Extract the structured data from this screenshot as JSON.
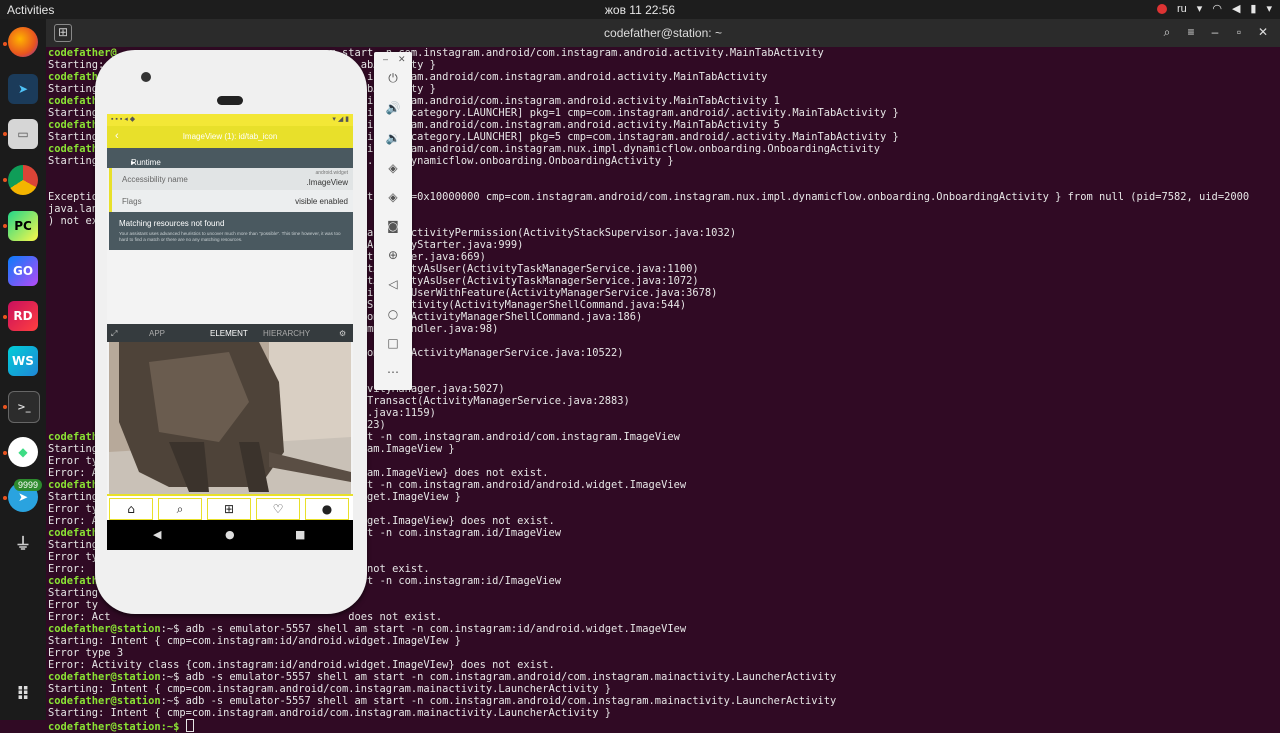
{
  "topbar": {
    "activities": "Activities",
    "clock": "жов 11  22:56",
    "lang": "ru"
  },
  "dock": {
    "telegram_badge": "9999"
  },
  "terminal": {
    "title": "codefather@station: ~",
    "prompt": "codefather@station:~$"
  },
  "inspector": {
    "header_title": "ImageView (1): id/tab_icon",
    "runtime_state": "Runtime state",
    "accessibility_label": "Accessibility name",
    "accessibility_value_small": "android.widget",
    "accessibility_value": ".ImageView",
    "flags_label": "Flags",
    "flags_value": "visible  enabled",
    "not_found_title": "Matching resources not found",
    "not_found_desc": "Your assistant uses advanced heuristics to uncover much more than \"possible\". This time however, it was too hard to find a match or there are no any matching resources.",
    "tabs": [
      "APP",
      "ELEMENT",
      "HIERARCHY"
    ]
  },
  "icons": {
    "power": "power-icon",
    "vol_up": "volume-up-icon",
    "vol_down": "volume-down-icon",
    "rotate_left": "rotate-left-icon",
    "rotate_right": "rotate-right-icon",
    "camera": "camera-icon",
    "zoom": "zoom-icon",
    "back": "back-icon",
    "home": "home-icon",
    "overview": "overview-icon",
    "more": "more-icon"
  }
}
